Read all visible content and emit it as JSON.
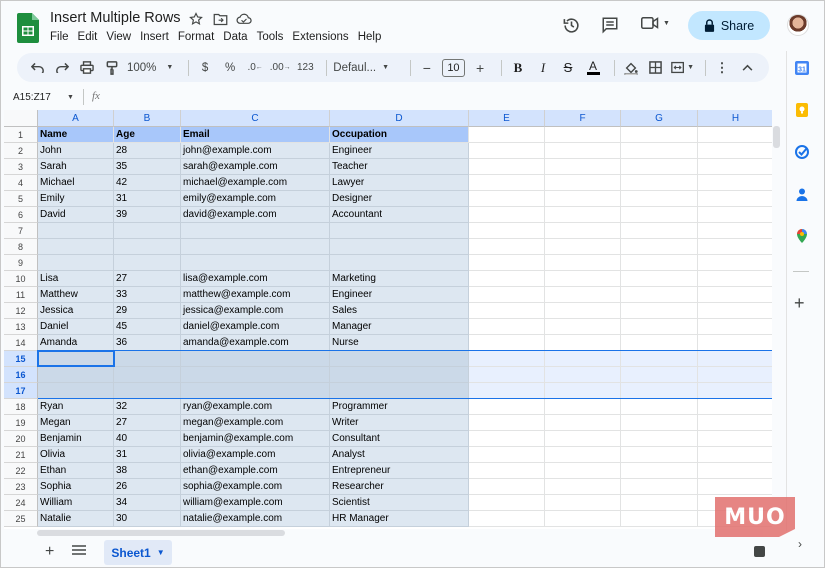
{
  "app": {
    "doc_title": "Insert Multiple Rows",
    "menu": [
      "File",
      "Edit",
      "View",
      "Insert",
      "Format",
      "Data",
      "Tools",
      "Extensions",
      "Help"
    ],
    "share_label": "Share"
  },
  "toolbar": {
    "zoom": "100%",
    "currency": "$",
    "percent": "%",
    "dec_decrease": ".0←",
    "dec_increase": ".00",
    "format_123": "123",
    "font": "Defaul...",
    "font_size": "10",
    "minus": "−",
    "plus": "+",
    "bold": "B",
    "italic": "I",
    "strike": "S",
    "text_color": "A"
  },
  "formula_bar": {
    "name_box": "A15:Z17",
    "fx": "fx"
  },
  "columns": [
    "A",
    "B",
    "C",
    "D",
    "E",
    "F",
    "G",
    "H"
  ],
  "rows": [
    {
      "n": "1",
      "cells": [
        "Name",
        "Age",
        "Email",
        "Occupation"
      ]
    },
    {
      "n": "2",
      "cells": [
        "John",
        "28",
        "john@example.com",
        "Engineer"
      ]
    },
    {
      "n": "3",
      "cells": [
        "Sarah",
        "35",
        "sarah@example.com",
        "Teacher"
      ]
    },
    {
      "n": "4",
      "cells": [
        "Michael",
        "42",
        "michael@example.com",
        "Lawyer"
      ]
    },
    {
      "n": "5",
      "cells": [
        "Emily",
        "31",
        "emily@example.com",
        "Designer"
      ]
    },
    {
      "n": "6",
      "cells": [
        "David",
        "39",
        "david@example.com",
        "Accountant"
      ]
    },
    {
      "n": "7",
      "cells": [
        "",
        "",
        "",
        ""
      ]
    },
    {
      "n": "8",
      "cells": [
        "",
        "",
        "",
        ""
      ]
    },
    {
      "n": "9",
      "cells": [
        "",
        "",
        "",
        ""
      ]
    },
    {
      "n": "10",
      "cells": [
        "Lisa",
        "27",
        "lisa@example.com",
        "Marketing"
      ]
    },
    {
      "n": "11",
      "cells": [
        "Matthew",
        "33",
        "matthew@example.com",
        "Engineer"
      ]
    },
    {
      "n": "12",
      "cells": [
        "Jessica",
        "29",
        "jessica@example.com",
        "Sales"
      ]
    },
    {
      "n": "13",
      "cells": [
        "Daniel",
        "45",
        "daniel@example.com",
        "Manager"
      ]
    },
    {
      "n": "14",
      "cells": [
        "Amanda",
        "36",
        "amanda@example.com",
        "Nurse"
      ]
    },
    {
      "n": "15",
      "cells": [
        "",
        "",
        "",
        ""
      ]
    },
    {
      "n": "16",
      "cells": [
        "",
        "",
        "",
        ""
      ]
    },
    {
      "n": "17",
      "cells": [
        "",
        "",
        "",
        ""
      ]
    },
    {
      "n": "18",
      "cells": [
        "Ryan",
        "32",
        "ryan@example.com",
        "Programmer"
      ]
    },
    {
      "n": "19",
      "cells": [
        "Megan",
        "27",
        "megan@example.com",
        "Writer"
      ]
    },
    {
      "n": "20",
      "cells": [
        "Benjamin",
        "40",
        "benjamin@example.com",
        "Consultant"
      ]
    },
    {
      "n": "21",
      "cells": [
        "Olivia",
        "31",
        "olivia@example.com",
        "Analyst"
      ]
    },
    {
      "n": "22",
      "cells": [
        "Ethan",
        "38",
        "ethan@example.com",
        "Entrepreneur"
      ]
    },
    {
      "n": "23",
      "cells": [
        "Sophia",
        "26",
        "sophia@example.com",
        "Researcher"
      ]
    },
    {
      "n": "24",
      "cells": [
        "William",
        "34",
        "william@example.com",
        "Scientist"
      ]
    },
    {
      "n": "25",
      "cells": [
        "Natalie",
        "30",
        "natalie@example.com",
        "HR Manager"
      ]
    }
  ],
  "selection": {
    "rows": [
      "15",
      "16",
      "17"
    ],
    "active_cell": "A15"
  },
  "sheet_tab": "Sheet1",
  "watermark": "MUO",
  "colors": {
    "accent": "#1a73e8",
    "share_bg": "#c2e7ff",
    "header_fill": "#a8c7fa",
    "data_fill": "#dde7f1",
    "toolbar_bg": "#edf2fa"
  },
  "sidebar_icons": [
    "calendar-icon",
    "keep-icon",
    "tasks-icon",
    "contacts-icon",
    "maps-icon",
    "add-icon"
  ]
}
